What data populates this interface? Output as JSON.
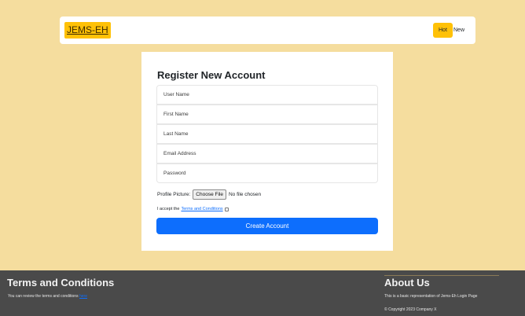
{
  "navbar": {
    "brand": "JEMS-EH",
    "links": [
      {
        "label": "Hot"
      },
      {
        "label": "New"
      }
    ]
  },
  "form": {
    "title": "Register New Account",
    "fields": [
      {
        "placeholder": "User Name"
      },
      {
        "placeholder": "First Name"
      },
      {
        "placeholder": "Last Name"
      },
      {
        "placeholder": "Email Address"
      },
      {
        "placeholder": "Password"
      }
    ],
    "file": {
      "label": "Profile Picture:",
      "button": "Choose File",
      "status": "No file chosen"
    },
    "terms": {
      "prefix": "I accept the",
      "link": "Terms and Conditions"
    },
    "submit": "Create Account"
  },
  "footer": {
    "left": {
      "title": "Terms and Conditions",
      "text": "You can review the terms and conditions",
      "link": "here"
    },
    "right": {
      "title": "About Us",
      "text": "This is a basic representation of Jems-Eh Login Page",
      "copyright": "© Copyright 2023 Company X"
    }
  },
  "colors": {
    "page_background": "#f5dd9e",
    "accent_yellow": "#ffc107",
    "primary_blue": "#0d6efd",
    "footer_background": "#4a4a4a"
  }
}
